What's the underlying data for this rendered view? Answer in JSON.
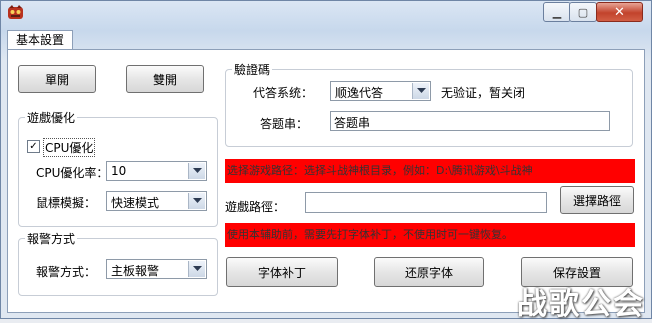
{
  "window": {
    "controls": {
      "minimize": "▁",
      "maximize": "▢",
      "close": "✕"
    }
  },
  "tabs": [
    "基本設置"
  ],
  "buttons": {
    "single": "單開",
    "double": "雙開"
  },
  "optimize": {
    "title": "遊戲優化",
    "cpu_checkbox_label": "CPU優化",
    "cpu_checked": true,
    "cpu_rate_label": "CPU優化率：",
    "cpu_rate_value": "10",
    "mouse_label": "鼠標模擬：",
    "mouse_value": "快速模式"
  },
  "alarm": {
    "title": "報警方式",
    "label": "報警方式：",
    "value": "主板報警"
  },
  "captcha": {
    "title": "驗證碼",
    "system_label": "代答系统：",
    "system_value": "顺逸代答",
    "status_text": "无验证，暂关闭",
    "code_label": "答题串：",
    "code_value": "答题串"
  },
  "path": {
    "hint": "选择游戏路径：选择斗战神根目录，例如：D:\\腾讯游戏\\斗战神",
    "label": "遊戲路徑：",
    "value": "",
    "select_button": "選擇路徑"
  },
  "notice": "使用本辅助前，需要先打字体补丁，不使用时可一键恢复。",
  "actions": {
    "font_patch": "字体补丁",
    "restore_font": "还原字体",
    "save": "保存設置"
  },
  "watermark": "战歌公会"
}
